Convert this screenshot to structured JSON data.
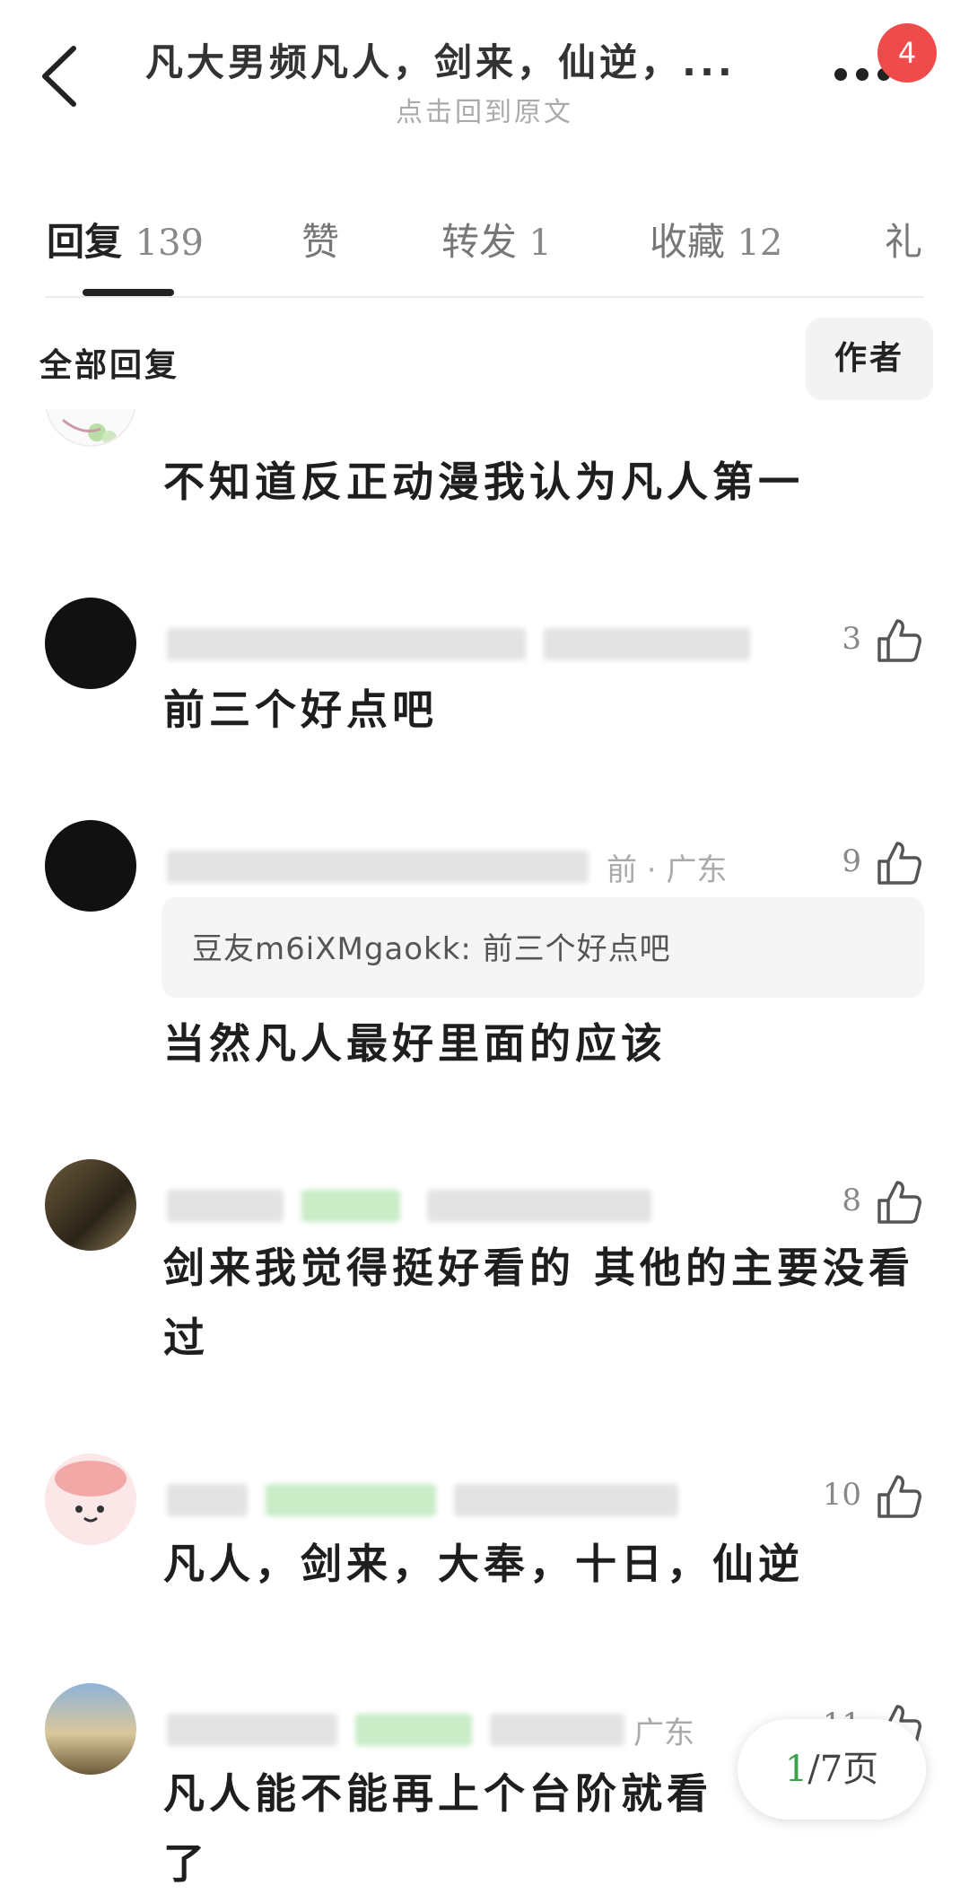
{
  "header": {
    "title": "凡大男频凡人，剑来，仙逆，...",
    "subtitle": "点击回到原文",
    "notification_count": "4"
  },
  "tabs": [
    {
      "label": "回复",
      "count": "139",
      "active": true
    },
    {
      "label": "赞",
      "count": ""
    },
    {
      "label": "转发",
      "count": "1"
    },
    {
      "label": "收藏",
      "count": "12"
    },
    {
      "label": "礼",
      "count": ""
    }
  ],
  "filter": {
    "label": "全部回复",
    "author_button": "作者"
  },
  "comments": [
    {
      "text": "不知道反正动漫我认为凡人第一",
      "likes": "",
      "meta_visible": ""
    },
    {
      "text": "前三个好点吧",
      "likes": "3",
      "meta_visible": ""
    },
    {
      "text": "当然凡人最好里面的应该",
      "likes": "9",
      "meta_visible": "前 · 广东",
      "quote": "豆友m6iXMgaokk: 前三个好点吧"
    },
    {
      "text": "剑来我觉得挺好看的 其他的主要没看过",
      "likes": "8",
      "meta_visible": ""
    },
    {
      "text": "凡人，剑来，大奉，十日，仙逆",
      "likes": "10",
      "meta_visible": ""
    },
    {
      "text": "凡人能不能再上个台阶就看了",
      "likes": "11",
      "meta_visible": "广东"
    }
  ],
  "pager": {
    "current": "1",
    "total_text": "/7页"
  },
  "colors": {
    "badge": "#ef4b4b",
    "pager_current": "#3aa14c",
    "tag_green": "#c9ecc6"
  }
}
